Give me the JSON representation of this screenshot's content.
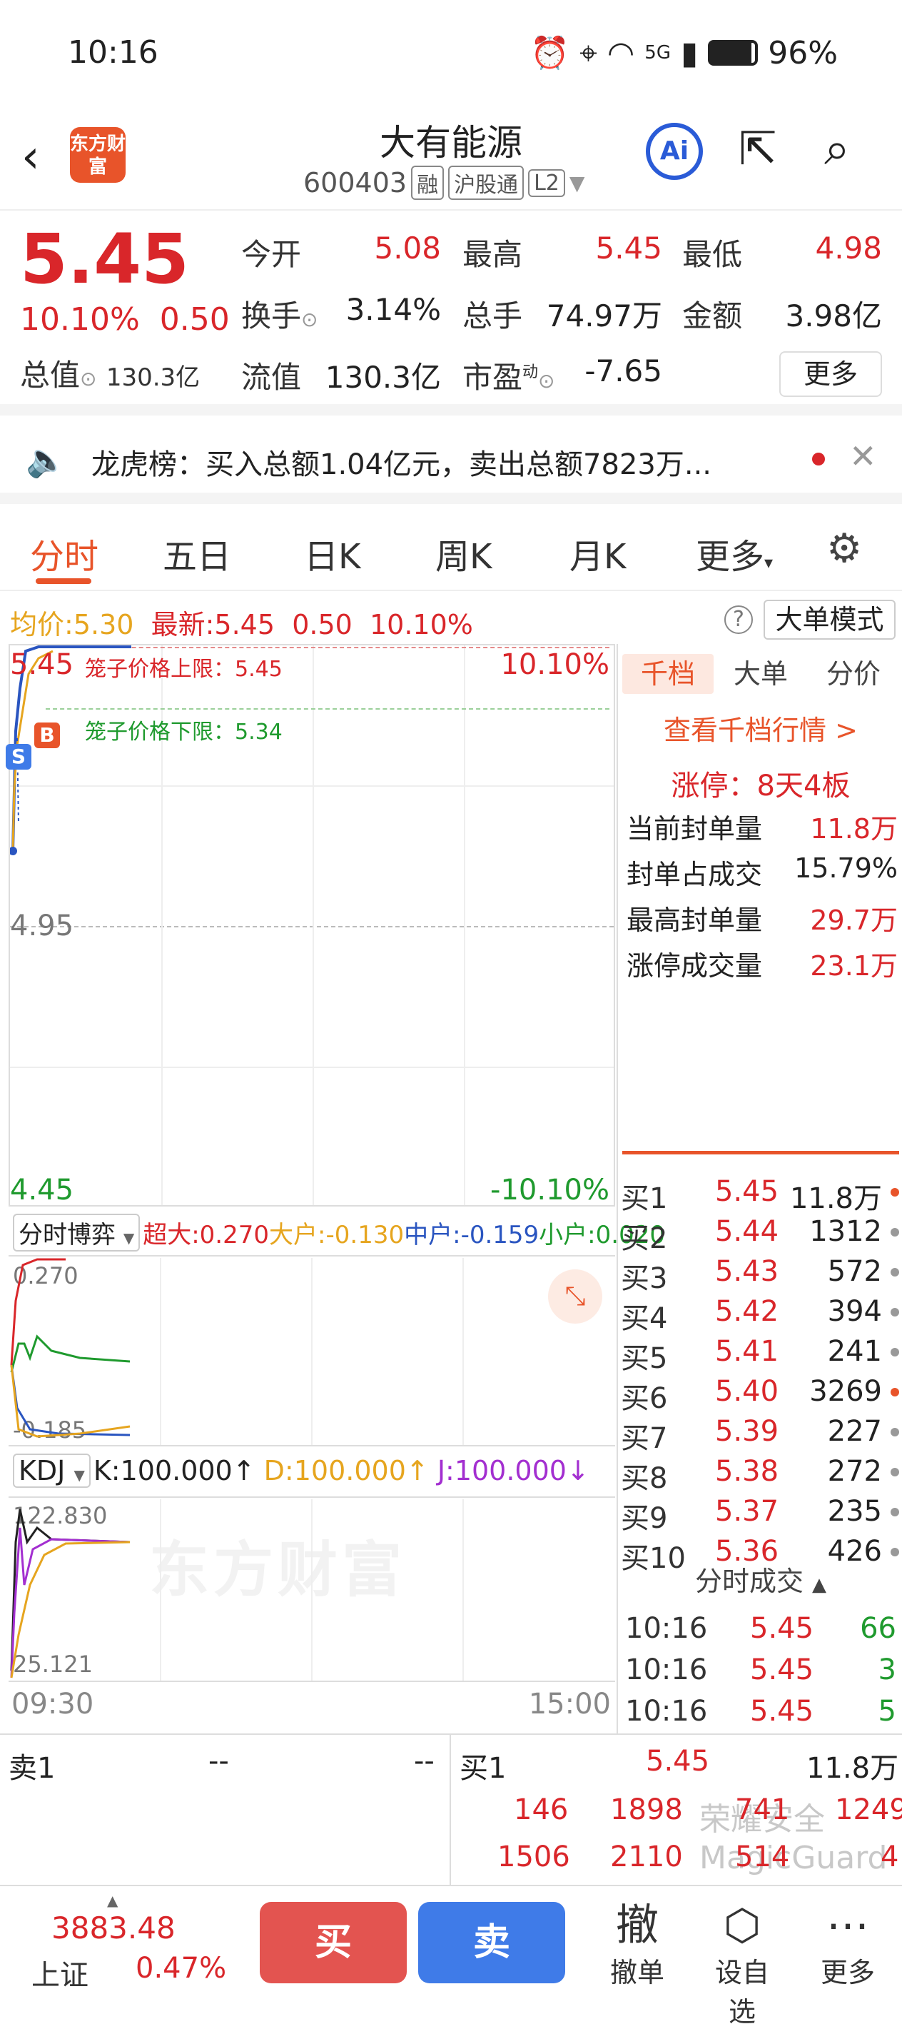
{
  "status": {
    "time": "10:16",
    "battery": "96%",
    "network": "5G"
  },
  "header": {
    "title": "大有能源",
    "code": "600403",
    "tags": [
      "融",
      "沪股通",
      "L2"
    ],
    "logo": "东方财富",
    "ai": "Ai"
  },
  "quote": {
    "price": "5.45",
    "pct": "10.10%",
    "chg": "0.50",
    "open_label": "今开",
    "open": "5.08",
    "high_label": "最高",
    "high": "5.45",
    "low_label": "最低",
    "low": "4.98",
    "turnover_label": "换手",
    "turnover": "3.14%",
    "volume_label": "总手",
    "volume": "74.97万",
    "amount_label": "金额",
    "amount": "3.98亿",
    "mcap_label": "总值",
    "mcap": "130.3亿",
    "float_label": "流值",
    "float": "130.3亿",
    "pe_label": "市盈",
    "pe_sup": "动",
    "pe": "-7.65",
    "more": "更多"
  },
  "notice": {
    "text": "龙虎榜：买入总额1.04亿元，卖出总额7823万..."
  },
  "tabs": [
    "分时",
    "五日",
    "日K",
    "周K",
    "月K",
    "更多"
  ],
  "infobar": {
    "avg_label": "均价:",
    "avg": "5.30",
    "latest_label": "最新:",
    "latest": "5.45",
    "chg": "0.50",
    "pct": "10.10%",
    "mode": "大单模式"
  },
  "chart": {
    "top_price": "5.45",
    "top_pct": "10.10%",
    "mid_price": "4.95",
    "bot_price": "4.45",
    "bot_pct": "-10.10%",
    "cage_up": "笼子价格上限：5.45",
    "cage_down": "笼子价格下限：5.34",
    "watermark": "东方财富"
  },
  "flow": {
    "selector": "分时博弈",
    "super_label": "超大:",
    "super": "0.270",
    "big_label": "大户:",
    "big": "-0.130",
    "mid_label": "中户:",
    "mid": "-0.159",
    "small_label": "小户:",
    "small": "0.020",
    "top": "0.270",
    "bottom": "-0.185"
  },
  "kdj": {
    "selector": "KDJ",
    "k": "K:100.000↑",
    "d": "D:100.000↑",
    "j": "J:100.000↓",
    "top": "122.830",
    "bottom": "25.121"
  },
  "timeaxis": {
    "start": "09:30",
    "end": "15:00"
  },
  "side": {
    "tabs": [
      "千档",
      "大单",
      "分价"
    ],
    "link": "查看千档行情 >",
    "limit": "涨停：8天4板",
    "stats": [
      {
        "label": "当前封单量",
        "value": "11.8万"
      },
      {
        "label": "封单占成交",
        "value": "15.79%"
      },
      {
        "label": "最高封单量",
        "value": "29.7万"
      },
      {
        "label": "涨停成交量",
        "value": "23.1万"
      }
    ],
    "bids": [
      {
        "name": "买1",
        "price": "5.45",
        "qty": "11.8万",
        "hl": true
      },
      {
        "name": "买2",
        "price": "5.44",
        "qty": "1312",
        "hl": false
      },
      {
        "name": "买3",
        "price": "5.43",
        "qty": "572",
        "hl": false
      },
      {
        "name": "买4",
        "price": "5.42",
        "qty": "394",
        "hl": false
      },
      {
        "name": "买5",
        "price": "5.41",
        "qty": "241",
        "hl": false
      },
      {
        "name": "买6",
        "price": "5.40",
        "qty": "3269",
        "hl": true
      },
      {
        "name": "买7",
        "price": "5.39",
        "qty": "227",
        "hl": false
      },
      {
        "name": "买8",
        "price": "5.38",
        "qty": "272",
        "hl": false
      },
      {
        "name": "买9",
        "price": "5.37",
        "qty": "235",
        "hl": false
      },
      {
        "name": "买10",
        "price": "5.36",
        "qty": "426",
        "hl": false
      }
    ],
    "ticks_title": "分时成交",
    "ticks": [
      {
        "t": "10:16",
        "p": "5.45",
        "v": "66"
      },
      {
        "t": "10:16",
        "p": "5.45",
        "v": "3"
      },
      {
        "t": "10:16",
        "p": "5.45",
        "v": "5"
      }
    ]
  },
  "bottom": {
    "sell1": "卖1",
    "sell1_p": "--",
    "sell1_q": "--",
    "buy1": "买1",
    "buy1_p": "5.45",
    "buy1_q": "11.8万",
    "q1": [
      "146",
      "1898",
      "741",
      "1249"
    ],
    "q2": [
      "1506",
      "2110",
      "514",
      "4"
    ],
    "magic1": "荣耀安全",
    "magic2": "MagicGuard"
  },
  "footer": {
    "index": "3883.48",
    "index_name": "上证",
    "index_pct": "0.47%",
    "buy": "买",
    "sell": "卖",
    "cancel": "撤单",
    "cancel_icon": "撤",
    "fav": "设自选",
    "more": "更多"
  },
  "colors": {
    "up": "#d9262a",
    "down": "#1f9a2e",
    "accent": "#e8542a",
    "buy_btn": "#e35450",
    "sell_btn": "#3f7be8"
  }
}
